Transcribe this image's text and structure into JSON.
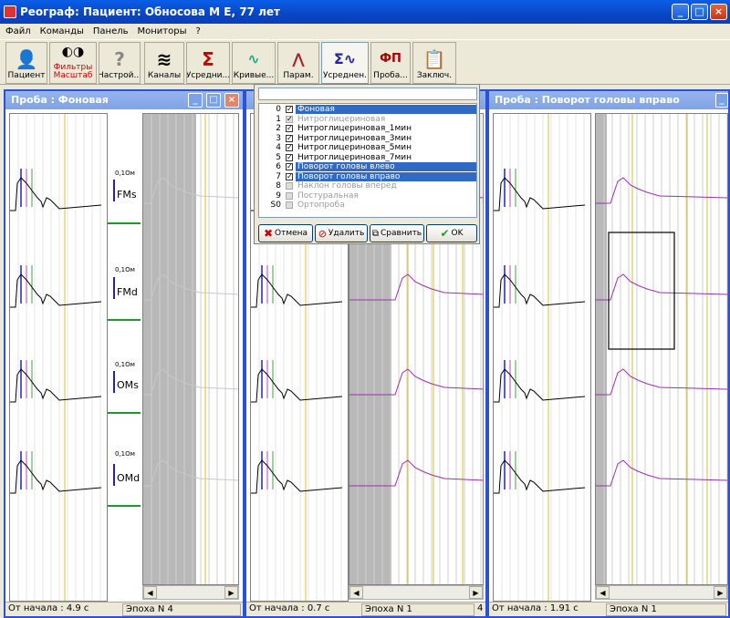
{
  "app": {
    "title": "Реограф: Пациент: Обноcова М Е, 77 лет"
  },
  "menu": [
    "Файл",
    "Команды",
    "Панель",
    "Мониторы",
    "?"
  ],
  "toolbar": [
    {
      "label": "Пациент",
      "icon": "patient-icon"
    },
    {
      "label": "Фильтры\nМасштаб",
      "icon": "filters-icon"
    },
    {
      "label": "Настрой...",
      "icon": "settings-icon"
    },
    {
      "label": "Каналы",
      "icon": "channels-icon"
    },
    {
      "label": "Усредни...",
      "icon": "sigma-icon"
    },
    {
      "label": "Кривые...",
      "icon": "curves-icon"
    },
    {
      "label": "Парам.",
      "icon": "params-icon"
    },
    {
      "label": "Усреднен.",
      "icon": "averaged-icon"
    },
    {
      "label": "Проба...",
      "icon": "fp-icon",
      "glyph": "ФП"
    },
    {
      "label": "Заключ.",
      "icon": "conclusion-icon"
    }
  ],
  "windows": {
    "left": {
      "title": "Проба : Фоновая",
      "status_time": "От начала : 4.9 с",
      "status_epoch": "Эпоха N 4"
    },
    "middle": {
      "status_time": "От начала : 0.7 с",
      "status_epoch": "Эпоха N 1",
      "status_extra": "4"
    },
    "right": {
      "title": "Проба : Поворот головы вправо",
      "status_time": "От начала : 1.91 с",
      "status_epoch": "Эпоха N 1"
    }
  },
  "channels": [
    {
      "name": "FMs",
      "scale": "0,1Ом"
    },
    {
      "name": "FMd",
      "scale": "0,1Ом"
    },
    {
      "name": "OMs",
      "scale": "0,1Ом"
    },
    {
      "name": "OMd",
      "scale": "0,1Ом"
    }
  ],
  "dialog": {
    "items": [
      {
        "num": "0",
        "label": "Фоновая",
        "checked": true,
        "selected": true,
        "enabled": true
      },
      {
        "num": "1",
        "label": "Нитроглицериновая",
        "checked": true,
        "selected": false,
        "enabled": false
      },
      {
        "num": "2",
        "label": "Нитроглицериновая_1мин",
        "checked": true,
        "selected": false,
        "enabled": true
      },
      {
        "num": "3",
        "label": "Нитроглицериновая_3мин",
        "checked": true,
        "selected": false,
        "enabled": true
      },
      {
        "num": "4",
        "label": "Нитроглицериновая_5мин",
        "checked": true,
        "selected": false,
        "enabled": true
      },
      {
        "num": "5",
        "label": "Нитроглицериновая_7мин",
        "checked": true,
        "selected": false,
        "enabled": true
      },
      {
        "num": "6",
        "label": "Поворот головы влево",
        "checked": true,
        "selected": true,
        "enabled": true
      },
      {
        "num": "7",
        "label": "Поворот головы вправо",
        "checked": true,
        "selected": true,
        "enabled": true
      },
      {
        "num": "8",
        "label": "Наклон головы вперед",
        "checked": false,
        "selected": false,
        "enabled": false
      },
      {
        "num": "9",
        "label": "Постуральная",
        "checked": false,
        "selected": false,
        "enabled": false
      },
      {
        "num": "S0",
        "label": "Ортопроба",
        "checked": false,
        "selected": false,
        "enabled": false
      }
    ],
    "buttons": {
      "cancel": "Отмена",
      "delete": "Удалить",
      "compare": "Сравнить",
      "ok": "OK"
    }
  },
  "colors": {
    "selection": "#316ac5",
    "purple_curve": "#9b2fae",
    "yellow_line": "#d8c22a",
    "green_line": "#1a9a2a",
    "blue_mark": "#2020c0"
  }
}
